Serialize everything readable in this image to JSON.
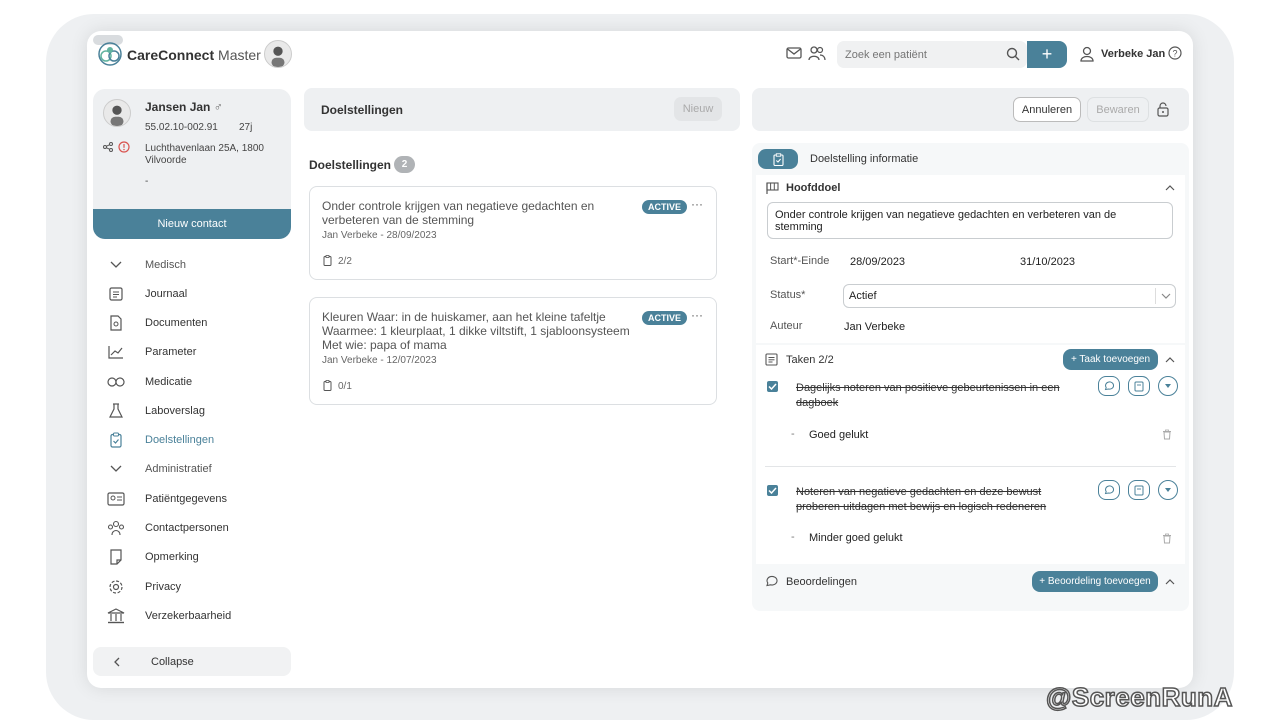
{
  "app": {
    "name": "CareConnect",
    "name_suffix": "Master"
  },
  "header": {
    "search_placeholder": "Zoek een patiënt",
    "user_name": "Verbeke Jan",
    "plus_label": "+"
  },
  "patient": {
    "name": "Jansen Jan",
    "gender_symbol": "♂",
    "id": "55.02.10-002.91",
    "age": "27j",
    "address_line1": "Luchthavenlaan 25A, 1800",
    "address_line2": "Vilvoorde",
    "extra": "-",
    "new_contact": "Nieuw contact"
  },
  "sidebar": {
    "items": [
      {
        "label": "Medisch",
        "icon": "chevron-down-icon"
      },
      {
        "label": "Journaal",
        "icon": "journal-icon"
      },
      {
        "label": "Documenten",
        "icon": "document-icon"
      },
      {
        "label": "Parameter",
        "icon": "chart-icon"
      },
      {
        "label": "Medicatie",
        "icon": "pills-icon"
      },
      {
        "label": "Laboverslag",
        "icon": "flask-icon"
      },
      {
        "label": "Doelstellingen",
        "icon": "clipboard-icon",
        "active": true
      },
      {
        "label": "Administratief",
        "icon": "chevron-down-icon"
      },
      {
        "label": "Patiëntgegevens",
        "icon": "id-card-icon"
      },
      {
        "label": "Contactpersonen",
        "icon": "people-icon"
      },
      {
        "label": "Opmerking",
        "icon": "note-icon"
      },
      {
        "label": "Privacy",
        "icon": "gear-icon"
      },
      {
        "label": "Verzekerbaarheid",
        "icon": "bank-icon"
      }
    ],
    "collapse": "Collapse"
  },
  "middle": {
    "title": "Doelstellingen",
    "new_button": "Nieuw",
    "list_title": "Doelstellingen",
    "count": "2",
    "goals": [
      {
        "line1": "Onder controle krijgen van negatieve gedachten en",
        "line2": "verbeteren van de stemming",
        "line3": "",
        "meta": "Jan Verbeke - 28/09/2023",
        "status": "ACTIVE",
        "progress": "2/2"
      },
      {
        "line1": "Kleuren Waar: in de huiskamer, aan het kleine tafeltje",
        "line2": "Waarmee: 1 kleurplaat, 1 dikke viltstift, 1 sjabloonsysteem",
        "line3": "Met wie: papa of mama",
        "meta": "Jan Verbeke - 12/07/2023",
        "status": "ACTIVE",
        "progress": "0/1"
      }
    ]
  },
  "right": {
    "cancel": "Annuleren",
    "save": "Bewaren",
    "tab_title": "Doelstelling informatie",
    "main_goal_title": "Hoofddoel",
    "main_goal_value": "Onder controle krijgen van negatieve gedachten en verbeteren van de stemming",
    "start_end_label": "Start*-Einde",
    "start_date": "28/09/2023",
    "end_date": "31/10/2023",
    "status_label": "Status*",
    "status_value": "Actief",
    "author_label": "Auteur",
    "author_value": "Jan Verbeke",
    "tasks_title": "Taken 2/2",
    "add_task": "+ Taak toevoegen",
    "tasks": [
      {
        "line1": "Dagelijks noteren van positieve gebeurtenissen in een",
        "line2": "dagboek",
        "result": "Goed gelukt"
      },
      {
        "line1": "Noteren van negatieve gedachten en deze bewust",
        "line2": "proberen uitdagen met bewijs en logisch redeneren",
        "result": "Minder goed gelukt"
      }
    ],
    "reviews_title": "Beoordelingen",
    "add_review": "+ Beoordeling toevoegen"
  },
  "watermark": "@ScreenRunA",
  "colors": {
    "accent": "#4a8199",
    "panel": "#eef0f2"
  }
}
